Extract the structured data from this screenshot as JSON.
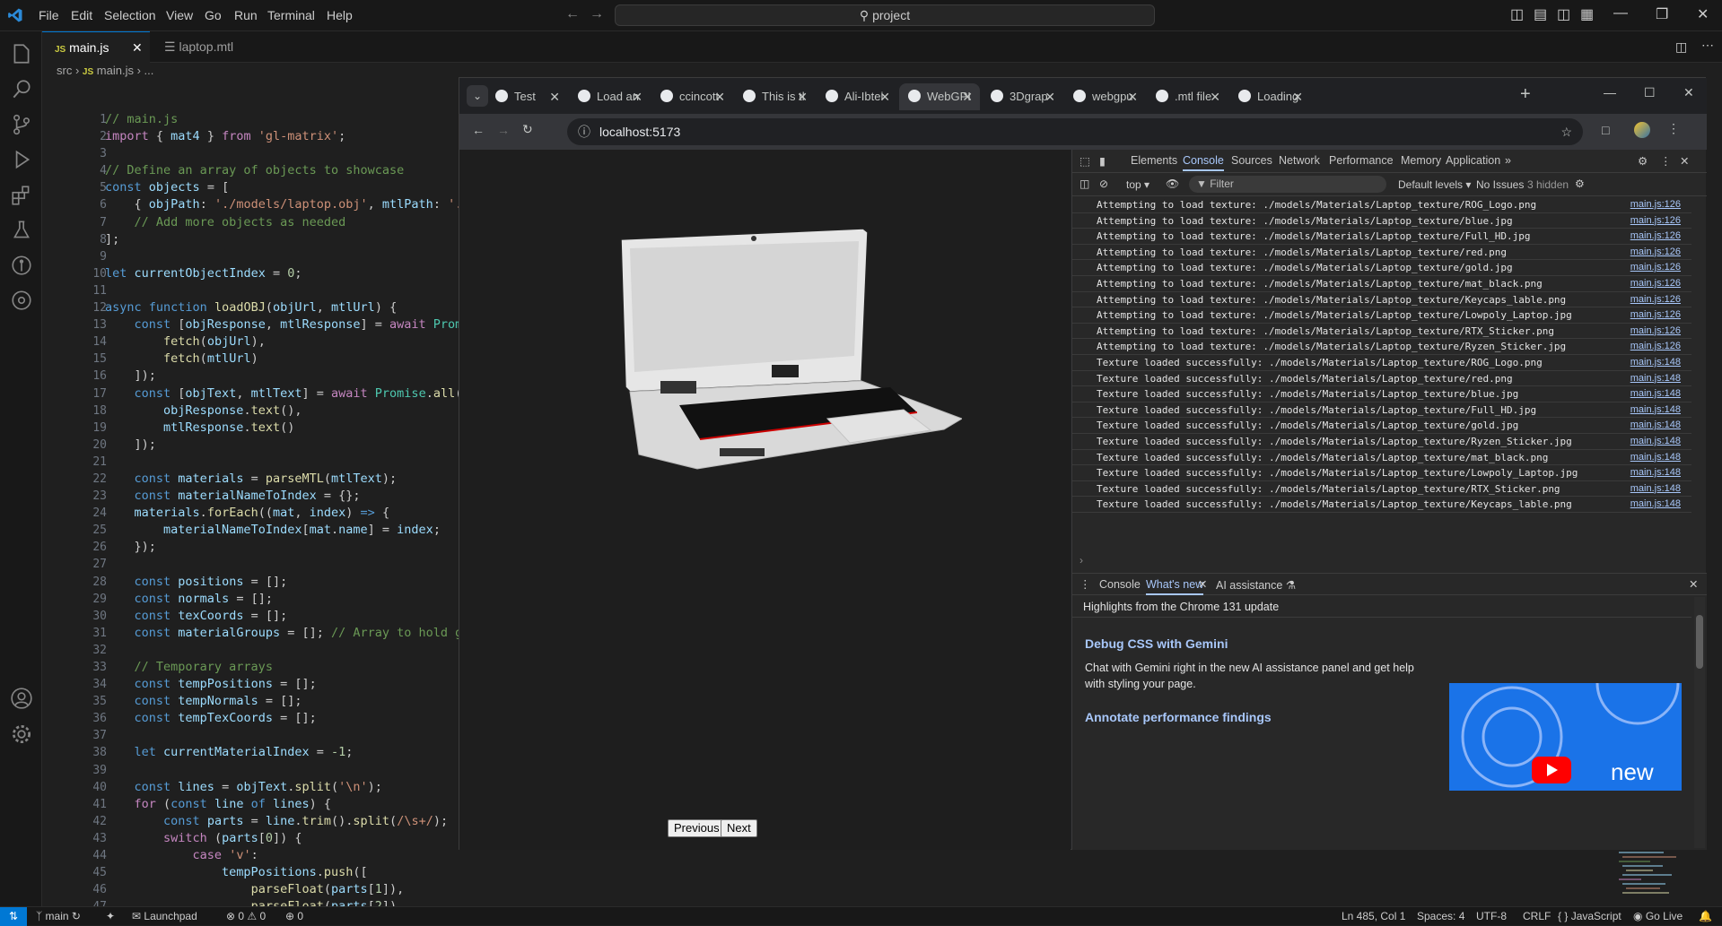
{
  "menu": [
    "File",
    "Edit",
    "Selection",
    "View",
    "Go",
    "Run",
    "Terminal",
    "Help"
  ],
  "command_center": "project",
  "editor_tabs": [
    {
      "label": "main.js",
      "badge": "JS",
      "active": true
    },
    {
      "label": "laptop.mtl",
      "active": false
    }
  ],
  "breadcrumb": {
    "folder": "src",
    "badge": "JS",
    "file": "main.js",
    "rest": "..."
  },
  "code_lines": [
    "<span class='c'>// main.js</span>",
    "<span class='kc'>import</span> { <span class='v'>mat4</span> } <span class='kc'>from</span> <span class='s'>'gl-matrix'</span>;",
    "",
    "<span class='c'>// Define an array of objects to showcase</span>",
    "<span class='k'>const</span> <span class='v'>objects</span> = [",
    "    { <span class='v'>objPath</span>: <span class='s'>'./models/laptop.obj'</span>, <span class='v'>mtlPath</span>: <span class='s'>'./mo</span>",
    "    <span class='c'>// Add more objects as needed</span>",
    "];",
    "",
    "<span class='k'>let</span> <span class='v'>currentObjectIndex</span> = <span class='n'>0</span>;",
    "",
    "<span class='k'>async</span> <span class='k'>function</span> <span class='f'>loadOBJ</span>(<span class='v'>objUrl</span>, <span class='v'>mtlUrl</span>) {",
    "    <span class='k'>const</span> [<span class='v'>objResponse</span>, <span class='v'>mtlResponse</span>] = <span class='kc'>await</span> <span class='t'>Promise</span>",
    "        <span class='f'>fetch</span>(<span class='v'>objUrl</span>),",
    "        <span class='f'>fetch</span>(<span class='v'>mtlUrl</span>)",
    "    ]);",
    "    <span class='k'>const</span> [<span class='v'>objText</span>, <span class='v'>mtlText</span>] = <span class='kc'>await</span> <span class='t'>Promise</span>.<span class='f'>all</span>([",
    "        <span class='v'>objResponse</span>.<span class='f'>text</span>(),",
    "        <span class='v'>mtlResponse</span>.<span class='f'>text</span>()",
    "    ]);",
    "",
    "    <span class='k'>const</span> <span class='v'>materials</span> = <span class='f'>parseMTL</span>(<span class='v'>mtlText</span>);",
    "    <span class='k'>const</span> <span class='v'>materialNameToIndex</span> = {};",
    "    <span class='v'>materials</span>.<span class='f'>forEach</span>((<span class='v'>mat</span>, <span class='v'>index</span>) <span class='k'>=></span> {",
    "        <span class='v'>materialNameToIndex</span>[<span class='v'>mat</span>.<span class='v'>name</span>] = <span class='v'>index</span>;",
    "    });",
    "",
    "    <span class='k'>const</span> <span class='v'>positions</span> = [];",
    "    <span class='k'>const</span> <span class='v'>normals</span> = [];",
    "    <span class='k'>const</span> <span class='v'>texCoords</span> = [];",
    "    <span class='k'>const</span> <span class='v'>materialGroups</span> = []; <span class='c'>// Array to hold gro</span>",
    "",
    "    <span class='c'>// Temporary arrays</span>",
    "    <span class='k'>const</span> <span class='v'>tempPositions</span> = [];",
    "    <span class='k'>const</span> <span class='v'>tempNormals</span> = [];",
    "    <span class='k'>const</span> <span class='v'>tempTexCoords</span> = [];",
    "",
    "    <span class='k'>let</span> <span class='v'>currentMaterialIndex</span> = <span class='n'>-1</span>;",
    "",
    "    <span class='k'>const</span> <span class='v'>lines</span> = <span class='v'>objText</span>.<span class='f'>split</span>(<span class='s'>'\\n'</span>);",
    "    <span class='kc'>for</span> (<span class='k'>const</span> <span class='v'>line</span> <span class='k'>of</span> <span class='v'>lines</span>) {",
    "        <span class='k'>const</span> <span class='v'>parts</span> = <span class='v'>line</span>.<span class='f'>trim</span>().<span class='f'>split</span>(<span class='s'>/\\s+/</span>);",
    "        <span class='kc'>switch</span> (<span class='v'>parts</span>[<span class='n'>0</span>]) {",
    "            <span class='kc'>case</span> <span class='s'>'v'</span>:",
    "                <span class='v'>tempPositions</span>.<span class='f'>push</span>([",
    "                    <span class='f'>parseFloat</span>(<span class='v'>parts</span>[<span class='n'>1</span>]),",
    "                    <span class='f'>parseFloat</span>(<span class='v'>parts</span>[<span class='n'>2</span>]),"
  ],
  "browser": {
    "tabs": [
      {
        "label": "Test"
      },
      {
        "label": "Load an"
      },
      {
        "label": "ccincott"
      },
      {
        "label": "This is tl"
      },
      {
        "label": "Ali-Ibtei"
      },
      {
        "label": "WebGPI",
        "active": true
      },
      {
        "label": "3Dgrap"
      },
      {
        "label": "webgpu"
      },
      {
        "label": ".mtl file"
      },
      {
        "label": "Loading"
      }
    ],
    "url": "localhost:5173",
    "prev_label": "Previous",
    "next_label": "Next"
  },
  "devtools": {
    "tabs": [
      "Elements",
      "Console",
      "Sources",
      "Network",
      "Performance",
      "Memory",
      "Application"
    ],
    "context": "top",
    "filter_placeholder": "Filter",
    "levels": "Default levels",
    "issues": "No Issues",
    "hidden": "3 hidden",
    "logs": [
      {
        "msg": "Attempting to load texture: ./models/Materials/Laptop_texture/ROG_Logo.png",
        "src": "main.js:126"
      },
      {
        "msg": "Attempting to load texture: ./models/Materials/Laptop_texture/blue.jpg",
        "src": "main.js:126"
      },
      {
        "msg": "Attempting to load texture: ./models/Materials/Laptop_texture/Full_HD.jpg",
        "src": "main.js:126"
      },
      {
        "msg": "Attempting to load texture: ./models/Materials/Laptop_texture/red.png",
        "src": "main.js:126"
      },
      {
        "msg": "Attempting to load texture: ./models/Materials/Laptop_texture/gold.jpg",
        "src": "main.js:126"
      },
      {
        "msg": "Attempting to load texture: ./models/Materials/Laptop_texture/mat_black.png",
        "src": "main.js:126"
      },
      {
        "msg": "Attempting to load texture: ./models/Materials/Laptop_texture/Keycaps_lable.png",
        "src": "main.js:126"
      },
      {
        "msg": "Attempting to load texture: ./models/Materials/Laptop_texture/Lowpoly_Laptop.jpg",
        "src": "main.js:126"
      },
      {
        "msg": "Attempting to load texture: ./models/Materials/Laptop_texture/RTX_Sticker.png",
        "src": "main.js:126"
      },
      {
        "msg": "Attempting to load texture: ./models/Materials/Laptop_texture/Ryzen_Sticker.jpg",
        "src": "main.js:126"
      },
      {
        "msg": "Texture loaded successfully: ./models/Materials/Laptop_texture/ROG_Logo.png",
        "src": "main.js:148"
      },
      {
        "msg": "Texture loaded successfully: ./models/Materials/Laptop_texture/red.png",
        "src": "main.js:148"
      },
      {
        "msg": "Texture loaded successfully: ./models/Materials/Laptop_texture/blue.jpg",
        "src": "main.js:148"
      },
      {
        "msg": "Texture loaded successfully: ./models/Materials/Laptop_texture/Full_HD.jpg",
        "src": "main.js:148"
      },
      {
        "msg": "Texture loaded successfully: ./models/Materials/Laptop_texture/gold.jpg",
        "src": "main.js:148"
      },
      {
        "msg": "Texture loaded successfully: ./models/Materials/Laptop_texture/Ryzen_Sticker.jpg",
        "src": "main.js:148"
      },
      {
        "msg": "Texture loaded successfully: ./models/Materials/Laptop_texture/mat_black.png",
        "src": "main.js:148"
      },
      {
        "msg": "Texture loaded successfully: ./models/Materials/Laptop_texture/Lowpoly_Laptop.jpg",
        "src": "main.js:148"
      },
      {
        "msg": "Texture loaded successfully: ./models/Materials/Laptop_texture/RTX_Sticker.png",
        "src": "main.js:148"
      },
      {
        "msg": "Texture loaded successfully: ./models/Materials/Laptop_texture/Keycaps_lable.png",
        "src": "main.js:148"
      }
    ],
    "drawer": {
      "tabs": [
        "Console",
        "What's new",
        "AI assistance"
      ],
      "highlights": "Highlights from the Chrome 131 update",
      "item1_title": "Debug CSS with Gemini",
      "item1_body": "Chat with Gemini right in the new AI assistance panel and get help with styling your page.",
      "item2_title": "Annotate performance findings",
      "card_word": "new"
    }
  },
  "status": {
    "branch": "main",
    "launchpad": "Launchpad",
    "errors": "0",
    "warnings": "0",
    "ports": "0",
    "position": "Ln 485, Col 1",
    "spaces": "Spaces: 4",
    "encoding": "UTF-8",
    "eol": "CRLF",
    "language": "JavaScript",
    "golive": "Go Live"
  },
  "colors": {
    "accent": "#0078d4",
    "link": "#a8c7fa",
    "code_bg": "#1f1f1f"
  }
}
